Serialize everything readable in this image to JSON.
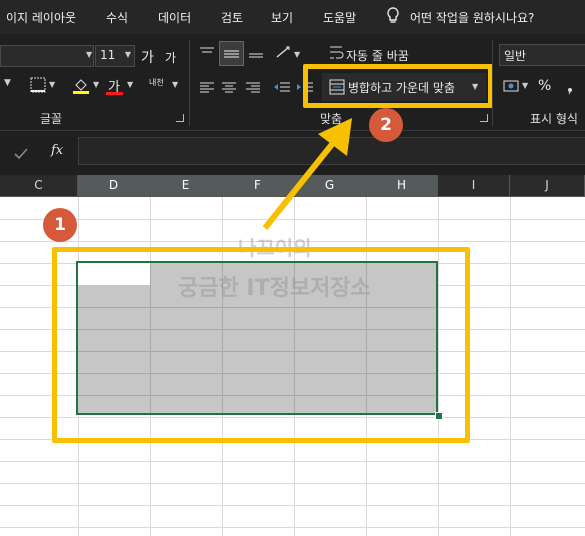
{
  "menu": {
    "items": [
      "이지 레이아웃",
      "수식",
      "데이터",
      "검토",
      "보기",
      "도움말"
    ],
    "tell_me_placeholder": "어떤 작업을 원하시나요?"
  },
  "ribbon": {
    "font_size_value": "11",
    "grow_font_glyph": "가",
    "shrink_font_glyph": "가",
    "font_color_glyph": "가",
    "phonetic_glyph": "내천",
    "wrap_text_label": "자동 줄 바꿈",
    "merge_center_label": "병합하고 가운데 맞춤",
    "number_format_value": "일반",
    "percent_glyph": "%",
    "group_labels": {
      "font": "글꼴",
      "alignment": "맞춤",
      "number": "표시 형식"
    }
  },
  "formula_bar": {
    "fx_label": "fx",
    "value": ""
  },
  "columns": [
    "C",
    "D",
    "E",
    "F",
    "G",
    "H",
    "I",
    "J"
  ],
  "callouts": {
    "step1": "1",
    "step2": "2"
  },
  "watermark": {
    "line1": "나꼬이의",
    "line2": "궁금한 IT정보저장소"
  },
  "colors": {
    "accent_yellow": "#f9c000",
    "callout_red": "#d65a3a",
    "selection_fill": "#c6c6c6",
    "selection_border": "#217346"
  }
}
